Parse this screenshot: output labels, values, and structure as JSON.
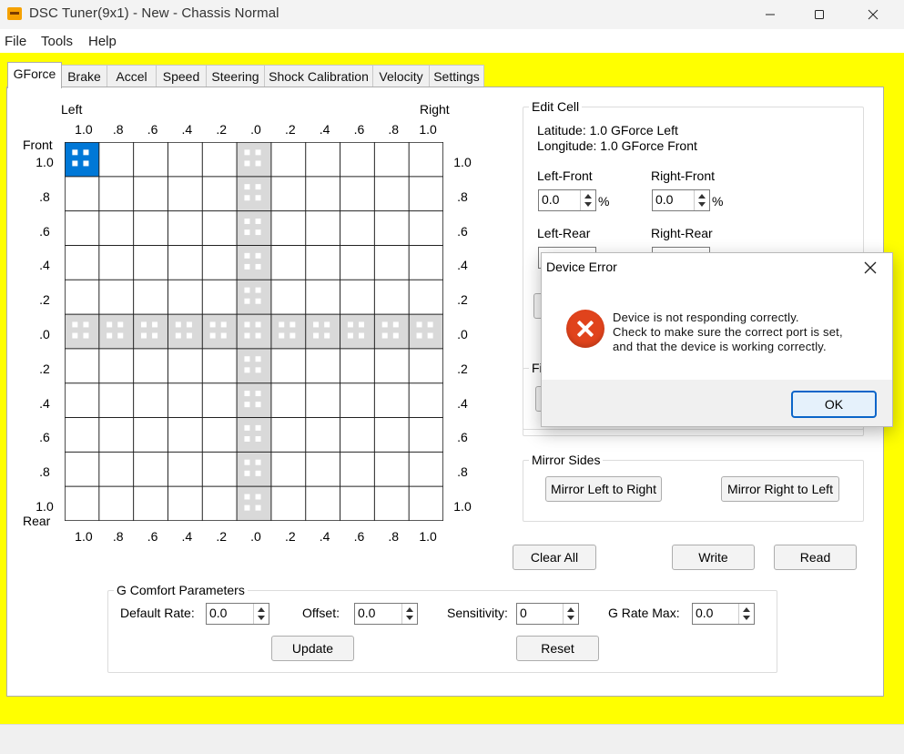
{
  "window": {
    "title": "DSC Tuner(9x1) - New - Chassis Normal"
  },
  "menu": [
    "File",
    "Tools",
    "Help"
  ],
  "tabs": [
    "GForce",
    "Brake",
    "Accel",
    "Speed",
    "Steering",
    "Shock Calibration",
    "Velocity",
    "Settings"
  ],
  "grid": {
    "left_label": "Left",
    "right_label": "Right",
    "front_label": "Front",
    "rear_label": "Rear",
    "x_ticks": [
      "1.0",
      ".8",
      ".6",
      ".4",
      ".2",
      ".0",
      ".2",
      ".4",
      ".6",
      ".8",
      "1.0"
    ],
    "y_ticks": [
      "1.0",
      ".8",
      ".6",
      ".4",
      ".2",
      ".0",
      ".2",
      ".4",
      ".6",
      ".8",
      "1.0"
    ],
    "selected_cell": {
      "latitude": "1.0 Left",
      "longitude": "1.0 Front"
    },
    "colors": {
      "selected": "#0078d7",
      "axis_band": "#d9d9d9",
      "grid_line": "#000000"
    }
  },
  "edit_cell": {
    "title": "Edit Cell",
    "latitude": "Latitude: 1.0 GForce Left",
    "longitude": "Longitude: 1.0 GForce Front",
    "left_front_label": "Left-Front",
    "left_front_value": "0.0",
    "right_front_label": "Right-Front",
    "right_front_value": "0.0",
    "left_rear_label": "Left-Rear",
    "right_rear_label": "Right-Rear",
    "percent": "%"
  },
  "partial_group_title": "Fi",
  "mirror": {
    "title": "Mirror Sides",
    "left_to_right": "Mirror Left to Right",
    "right_to_left": "Mirror Right to Left"
  },
  "actions": {
    "clear_all": "Clear All",
    "write": "Write",
    "read": "Read"
  },
  "comfort": {
    "title": "G Comfort Parameters",
    "default_rate_label": "Default Rate:",
    "default_rate_value": "0.0",
    "offset_label": "Offset:",
    "offset_value": "0.0",
    "sensitivity_label": "Sensitivity:",
    "sensitivity_value": "0",
    "g_rate_max_label": "G Rate Max:",
    "g_rate_max_value": "0.0",
    "update": "Update",
    "reset": "Reset"
  },
  "dialog": {
    "title": "Device Error",
    "lines": [
      "Device is not responding correctly.",
      "Check to make sure the correct port is set,",
      "and that the device is working correctly."
    ],
    "ok": "OK",
    "icon": "error-icon"
  },
  "colors": {
    "background_accent": "#ffff00",
    "error": "#e0431c",
    "ok_border": "#0a65c9"
  }
}
